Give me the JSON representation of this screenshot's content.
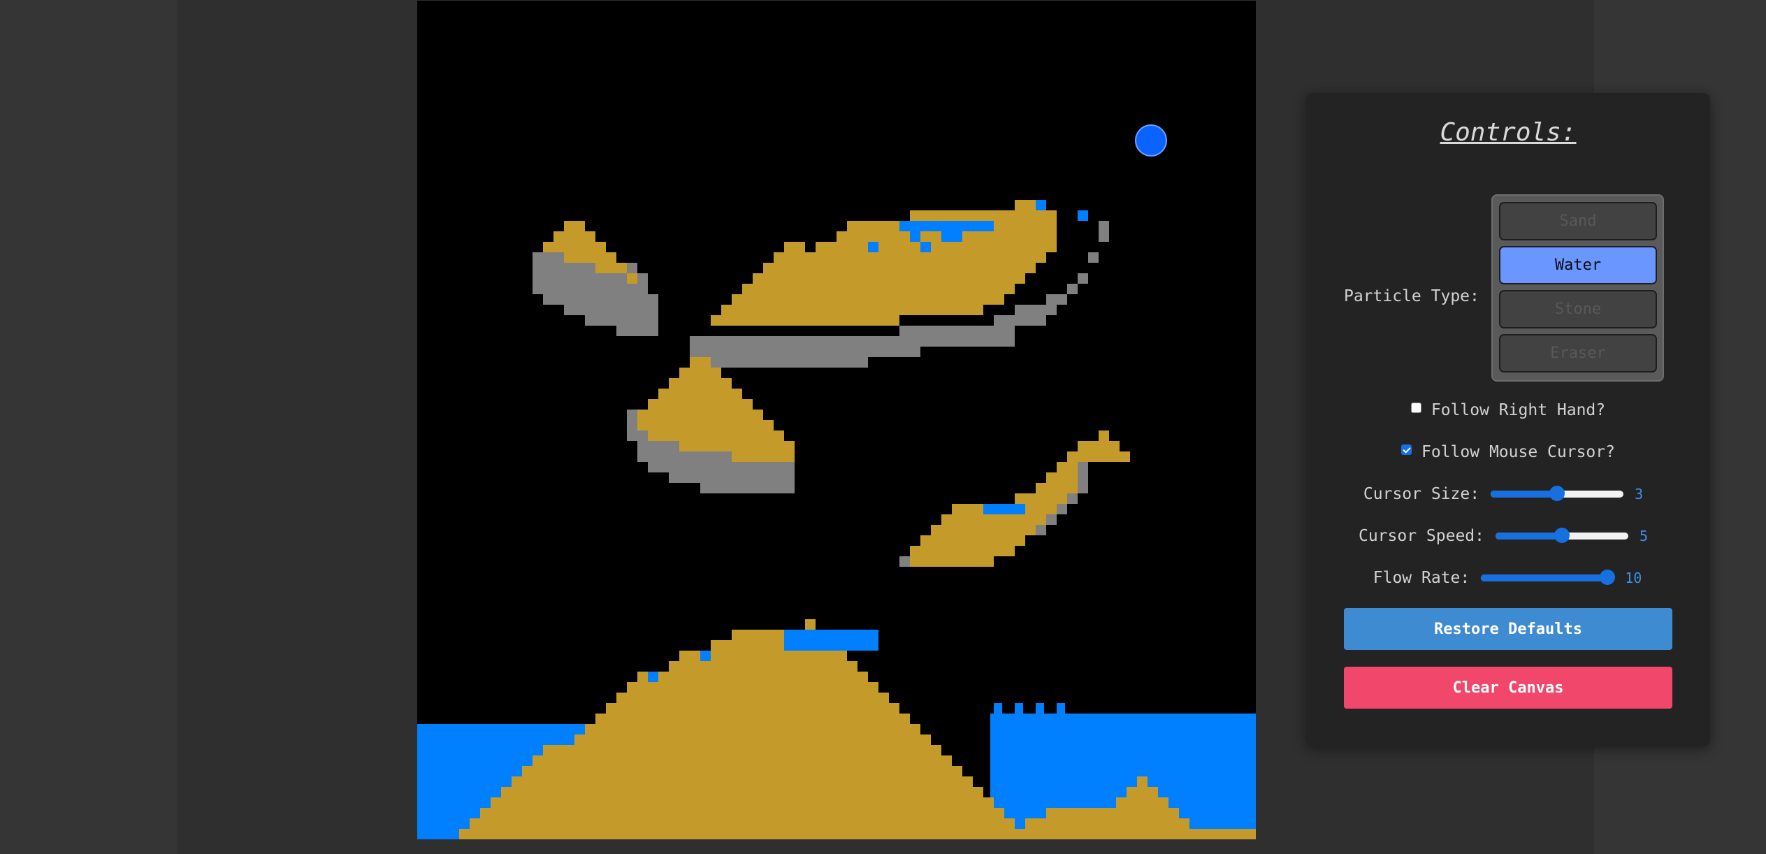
{
  "controls": {
    "title": "Controls:",
    "particle_type_label": "Particle Type:",
    "particle_types": [
      {
        "label": "Sand",
        "active": false
      },
      {
        "label": "Water",
        "active": true
      },
      {
        "label": "Stone",
        "active": false
      },
      {
        "label": "Eraser",
        "active": false
      }
    ],
    "follow_right_hand": {
      "label": "Follow Right Hand?",
      "checked": false
    },
    "follow_mouse_cursor": {
      "label": "Follow Mouse Cursor?",
      "checked": true
    },
    "cursor_size": {
      "label": "Cursor Size:",
      "value": "3",
      "fraction": 0.5
    },
    "cursor_speed": {
      "label": "Cursor Speed:",
      "value": "5",
      "fraction": 0.5
    },
    "flow_rate": {
      "label": "Flow Rate:",
      "value": "10",
      "fraction": 0.95
    },
    "restore_defaults": "Restore Defaults",
    "clear_canvas": "Clear Canvas"
  },
  "colors": {
    "sand": "#c49b2a",
    "water": "#0080ff",
    "stone": "#808080",
    "background": "#000000",
    "active_button": "#6a96ff",
    "restore_button": "#3f8bd2",
    "clear_button": "#f0476b"
  }
}
